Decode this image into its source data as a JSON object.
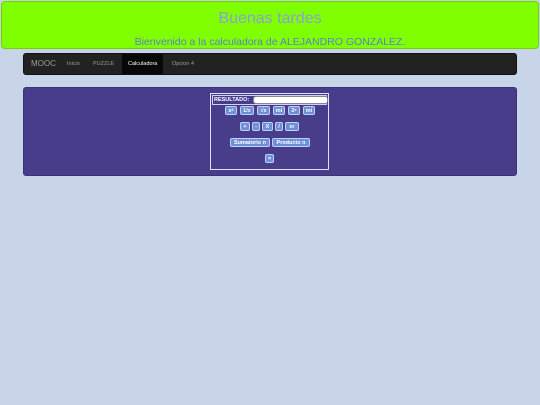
{
  "header": {
    "title": "Buenas tardes",
    "subtitle": "Bienvenido a la calculadora de ALEJANDRO GONZALEZ."
  },
  "navbar": {
    "brand": "MOOC",
    "items": [
      {
        "label": "Inicio",
        "active": false
      },
      {
        "label": "PUZZLE",
        "active": false
      },
      {
        "label": "Calculadora",
        "active": true
      },
      {
        "label": "Opcion 4",
        "active": false
      }
    ]
  },
  "calculator": {
    "result_label": "RESULTADO:",
    "result_value": "",
    "row_functions": [
      "x",
      "1/x",
      "√x",
      "mi",
      "2",
      "mi"
    ],
    "row_functions_sup": [
      "2",
      "",
      "",
      "",
      "x",
      ""
    ],
    "row_operators": [
      "+",
      "-",
      "X",
      "/",
      "x"
    ],
    "row_operators_sup": [
      "",
      "",
      "",
      "",
      "y"
    ],
    "sumatorio": "Sumatorio n",
    "producto": "Producto n",
    "equals": "="
  }
}
